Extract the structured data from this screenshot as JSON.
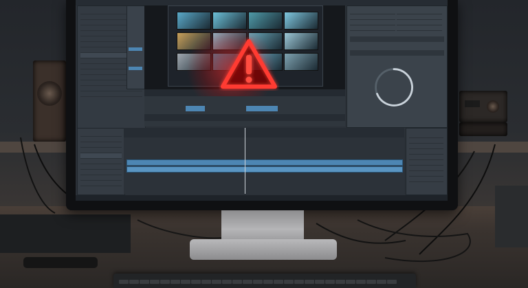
{
  "scene": {
    "description_items": [
      "room",
      "desk",
      "monitor",
      "speakers",
      "keyboard",
      "cables"
    ]
  },
  "editor": {
    "warning_icon": "warning-triangle-icon",
    "spinner_icon": "loading-ring-icon",
    "thumb_colors": [
      "#5aa9c9",
      "#6cc0d8",
      "#4f9aa8",
      "#7fc8e0",
      "#c9a05a",
      "#8fb6c8",
      "#6aa6b8",
      "#9cc7d6",
      "#a0a8b0",
      "#3f7f99",
      "#6fb0c9",
      "#7ea2b0"
    ],
    "accent": "#4d86b3",
    "warning_color": "#ff3b30"
  }
}
